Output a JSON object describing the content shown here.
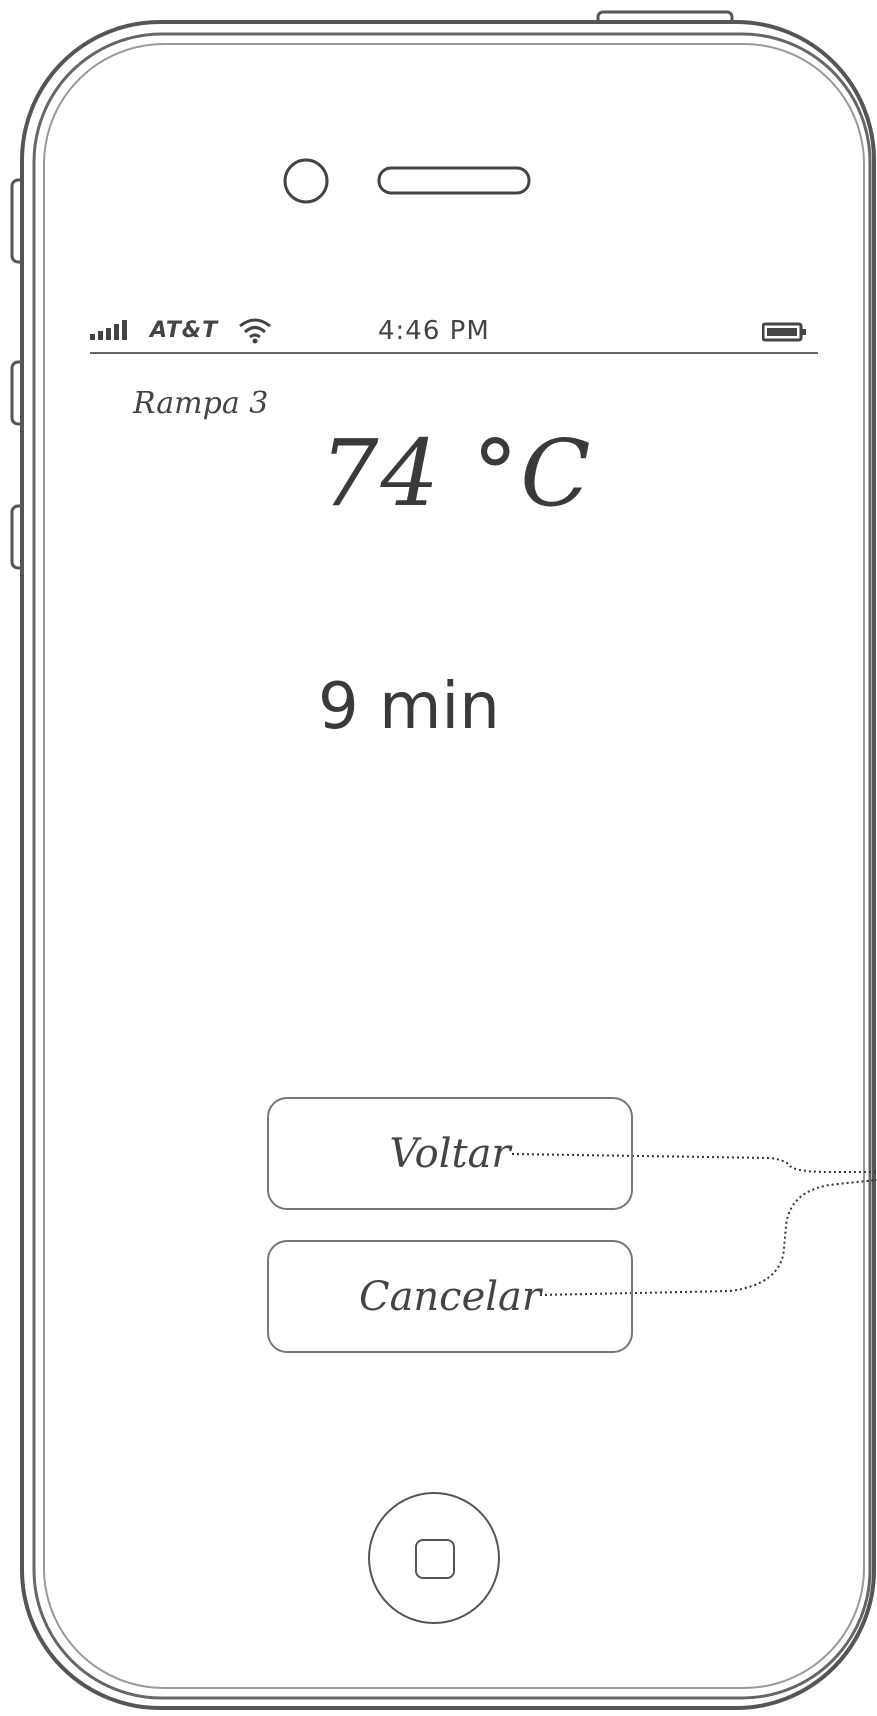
{
  "status_bar": {
    "carrier": "AT&T",
    "time": "4:46 PM"
  },
  "screen": {
    "program_label": "Rampa 3",
    "temperature": "74 °C",
    "duration": "9 min"
  },
  "buttons": {
    "back_label": "Voltar",
    "cancel_label": "Cancelar"
  },
  "icons": {
    "signal": "signal-bars-icon",
    "wifi": "wifi-icon",
    "battery": "battery-icon",
    "camera": "front-camera-icon",
    "speaker": "earpiece-speaker-icon",
    "home": "home-button-icon"
  }
}
